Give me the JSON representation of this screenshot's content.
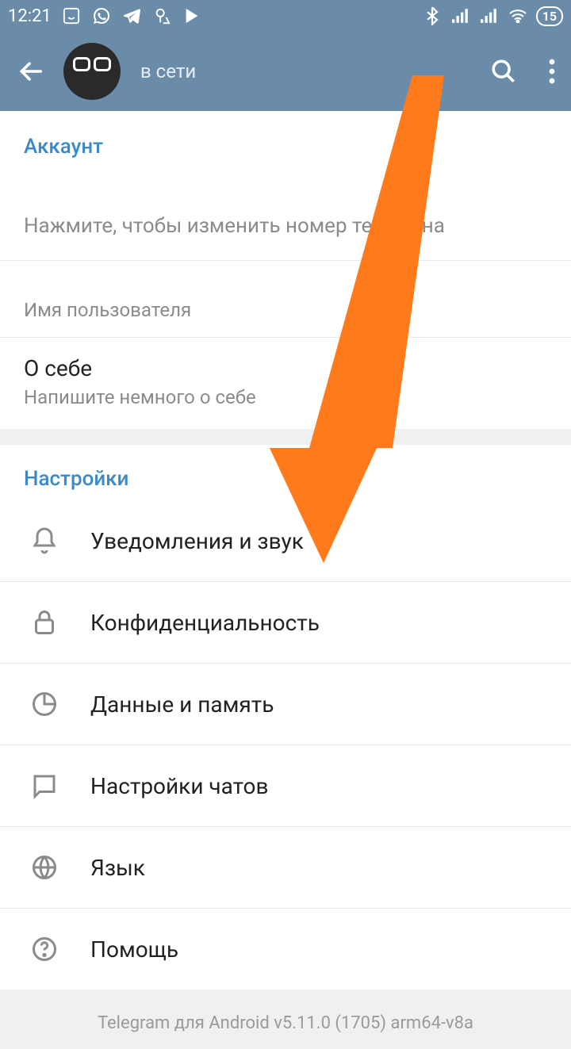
{
  "statusBar": {
    "time": "12:21",
    "battery": "15"
  },
  "header": {
    "status": "в сети"
  },
  "account": {
    "title": "Аккаунт",
    "phoneHint": "Нажмите, чтобы изменить номер телефона",
    "usernameHint": "Имя пользователя",
    "aboutTitle": "О себе",
    "aboutHint": "Напишите немного о себе"
  },
  "settings": {
    "title": "Настройки",
    "items": [
      {
        "label": "Уведомления и звук"
      },
      {
        "label": "Конфиденциальность"
      },
      {
        "label": "Данные и память"
      },
      {
        "label": "Настройки чатов"
      },
      {
        "label": "Язык"
      },
      {
        "label": "Помощь"
      }
    ]
  },
  "version": "Telegram для Android v5.11.0 (1705) arm64-v8a"
}
